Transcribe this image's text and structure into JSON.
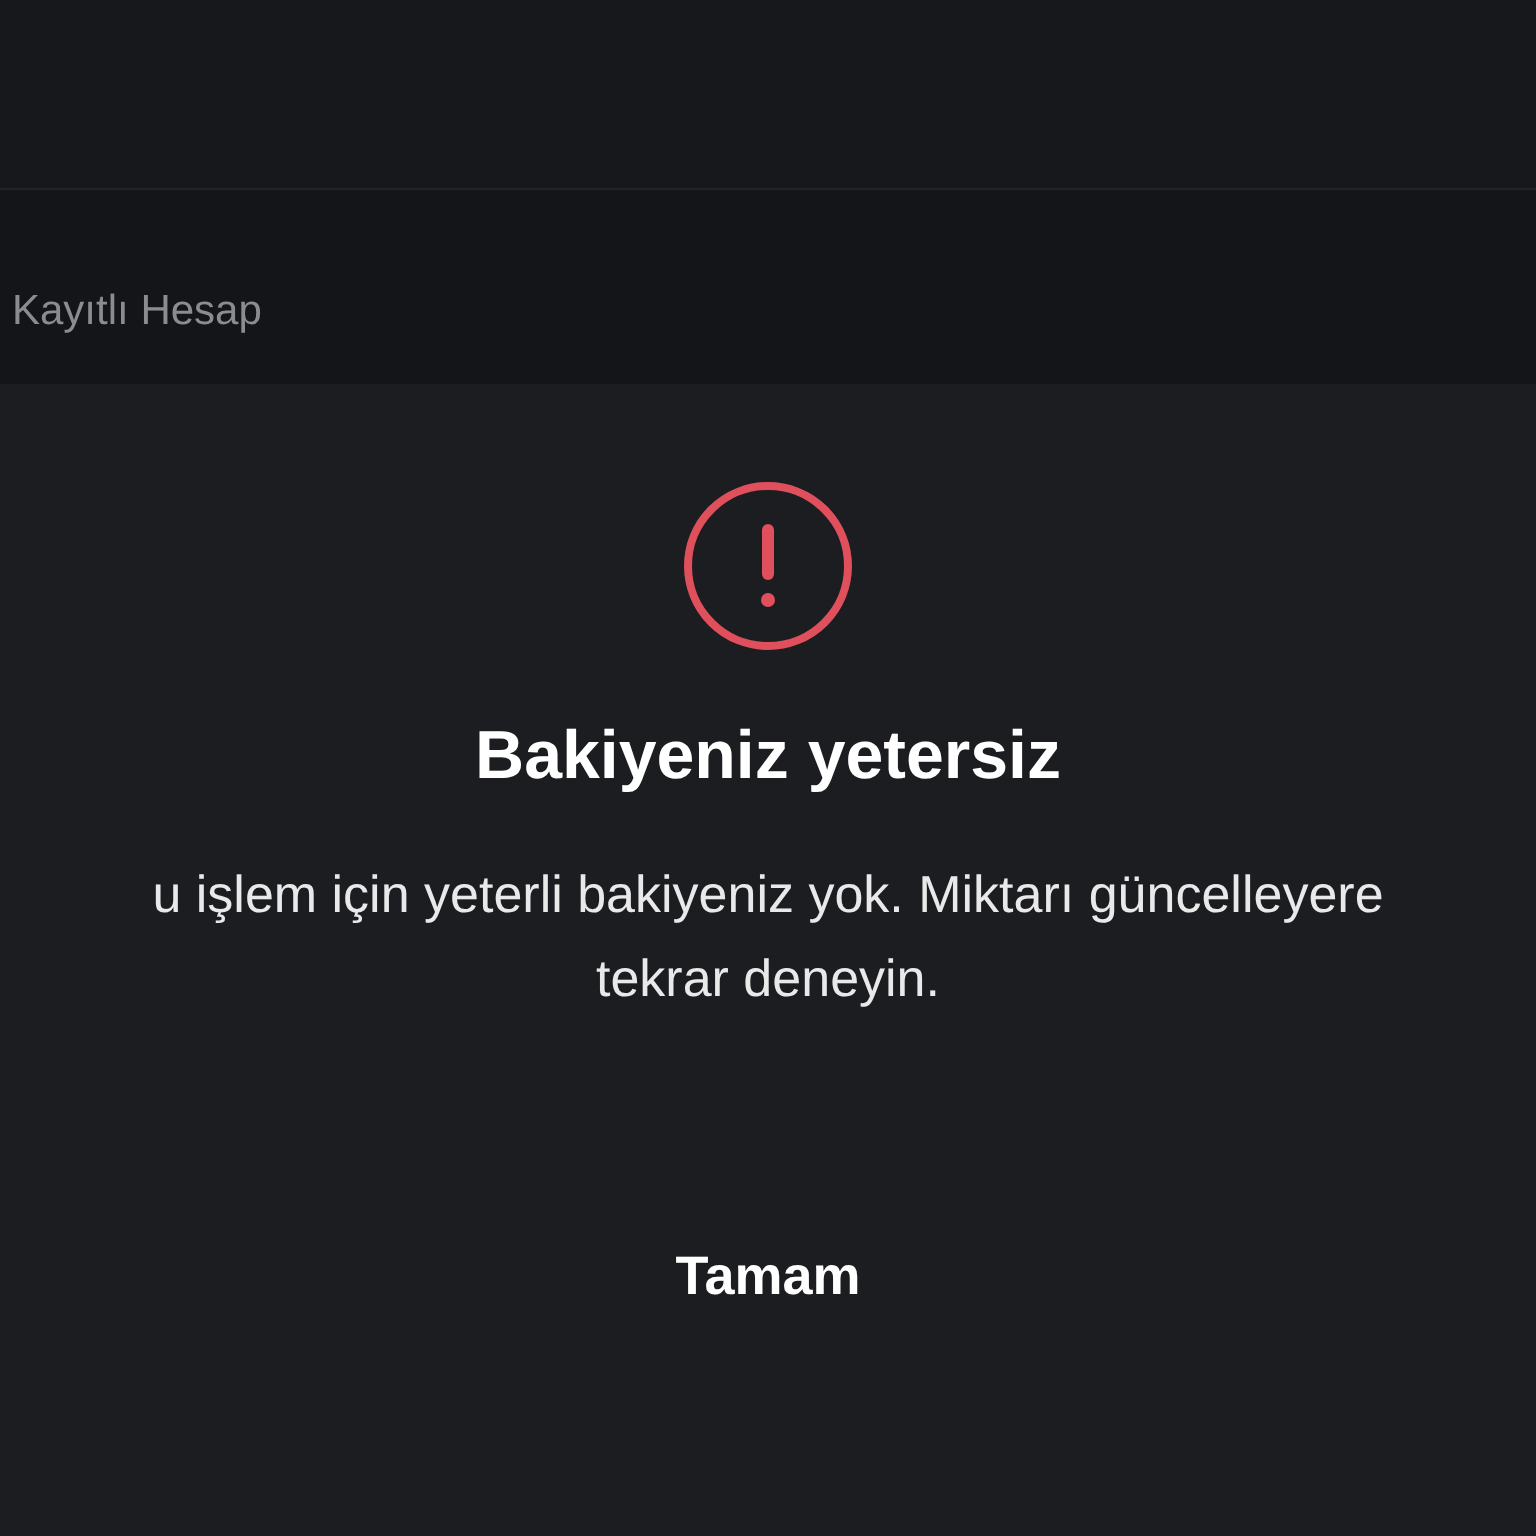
{
  "account": {
    "label": "Kayıtlı Hesap"
  },
  "dialog": {
    "title": "Bakiyeniz yetersiz",
    "message_lines": [
      "u işlem için yeterli bakiyeniz yok. Miktarı güncelleyere",
      "tekrar deneyin."
    ],
    "button": "Tamam"
  }
}
